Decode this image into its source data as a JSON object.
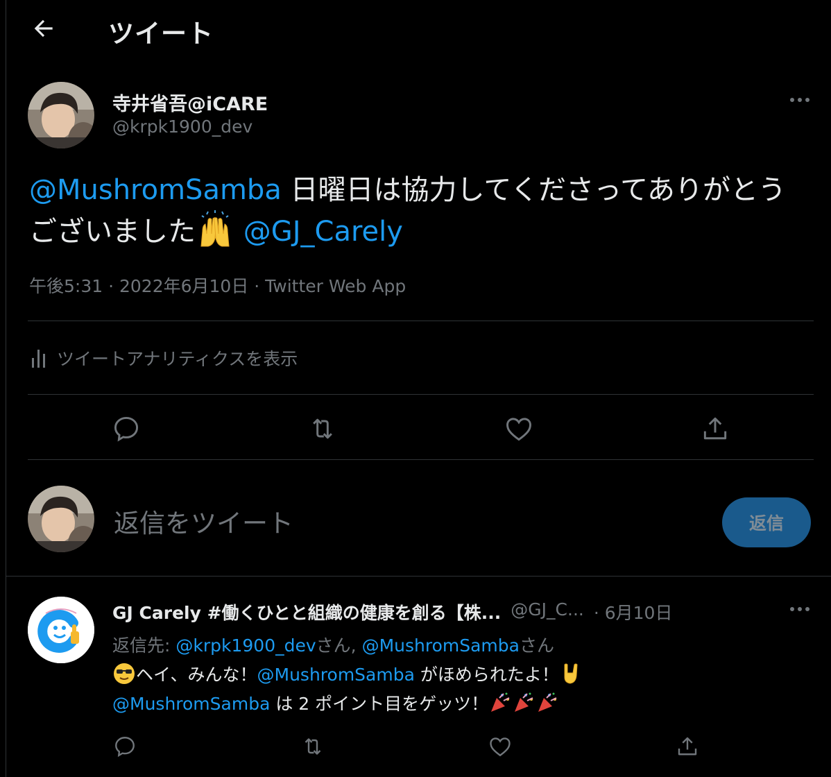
{
  "header": {
    "title": "ツイート",
    "back_icon": "arrow-left-icon"
  },
  "tweet": {
    "author": {
      "display_name": "寺井省吾@iCARE",
      "handle": "@krpk1900_dev"
    },
    "text": {
      "mention1": "@MushromSamba",
      "body": " 日曜日は協力してくださってありがとうございました",
      "emoji": "raising-hands",
      "space": " ",
      "mention2": "@GJ_Carely"
    },
    "meta": "午後5:31 · 2022年6月10日 · Twitter Web App",
    "analytics_label": "ツイートアナリティクスを表示"
  },
  "compose": {
    "placeholder": "返信をツイート",
    "reply_button": "返信"
  },
  "reply": {
    "author": {
      "display_name": "GJ Carely #働くひとと組織の健康を創る【株...",
      "handle": "@GJ_C...",
      "date": "· 6月10日"
    },
    "reply_to": {
      "prefix": "返信先: ",
      "user1": "@krpk1900_dev",
      "san1": "さん, ",
      "user2": "@MushromSamba",
      "san2": "さん"
    },
    "body": {
      "line1_text": "ヘイ、みんな！",
      "mention1": "@MushromSamba",
      "line1_rest": " がほめられたよ！",
      "mention2": "@MushromSamba",
      "line2_rest": " は 2 ポイント目をゲッツ！"
    }
  },
  "colors": {
    "background": "#000000",
    "text": "#e7e9ea",
    "secondary": "#71767b",
    "link": "#1d9bf0",
    "divider": "#2f3336",
    "button": "#1a5a8c"
  }
}
